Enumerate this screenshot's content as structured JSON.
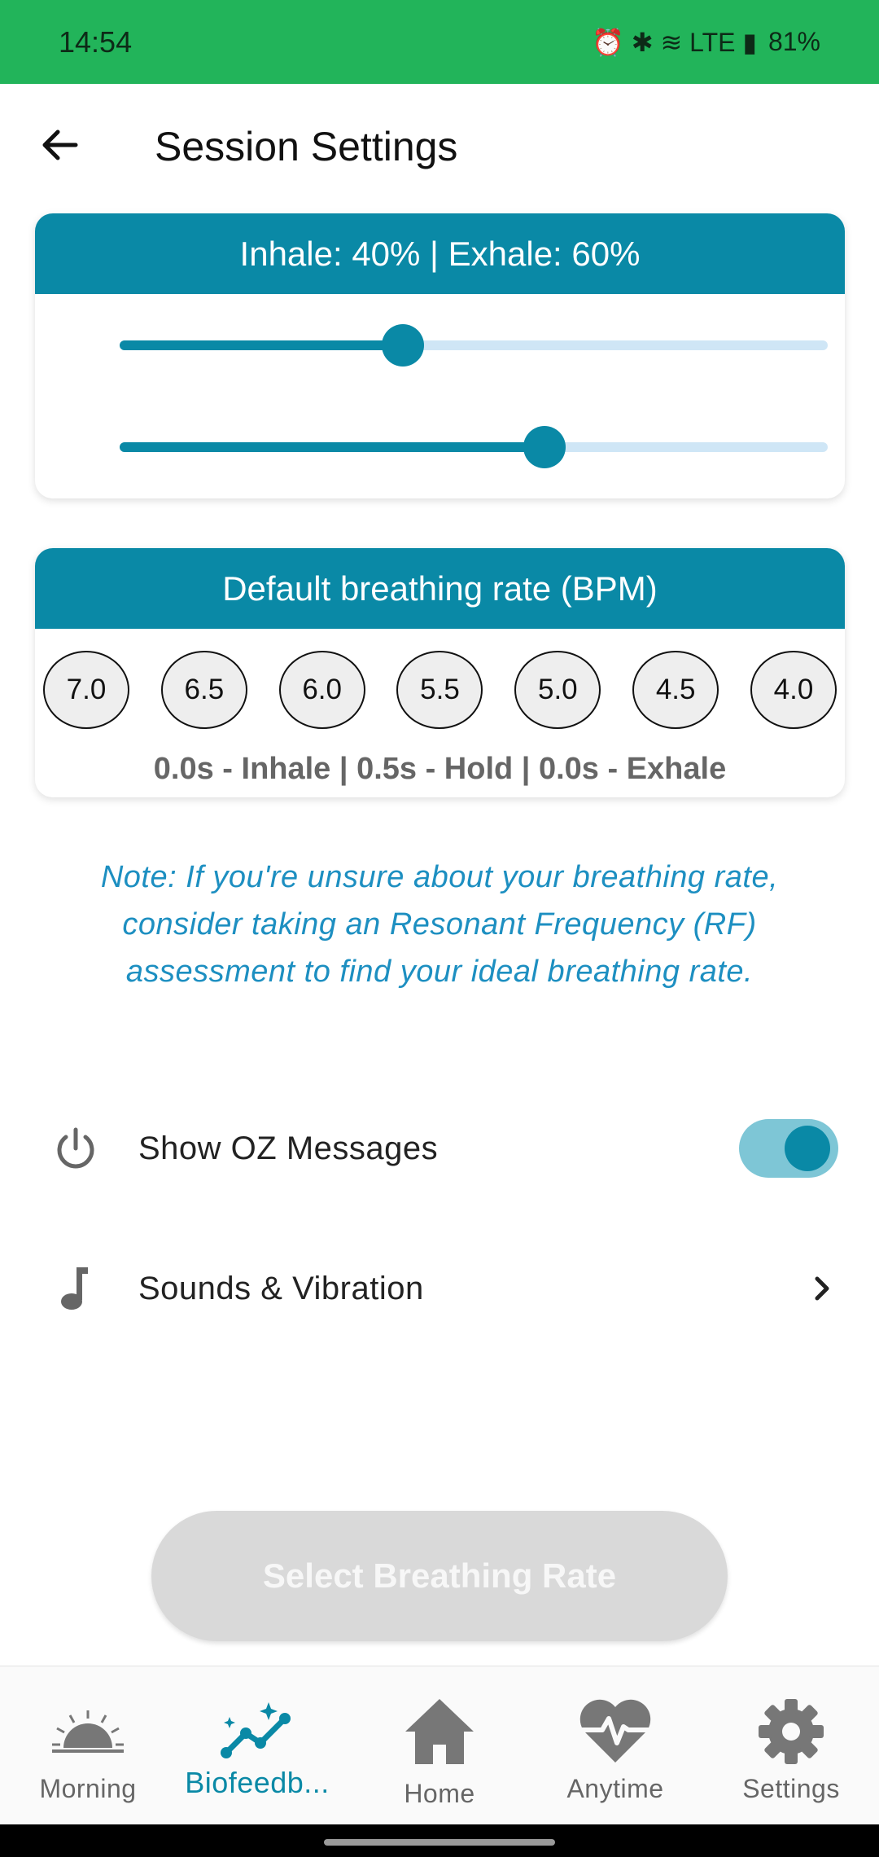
{
  "status_bar": {
    "time": "14:54",
    "indicators": "⏰ ✱ ≋ LTE ▮",
    "battery": "81%"
  },
  "header": {
    "back_icon": "arrow-left-icon",
    "title": "Session Settings"
  },
  "ratio_card": {
    "title": "Inhale: 40% | Exhale: 60%",
    "inhale_value": 0.4,
    "exhale_value": 0.6,
    "accent": "#0a89a6",
    "track": "#cfe6f6"
  },
  "rate_card": {
    "title": "Default breathing rate (BPM)",
    "rates": [
      "7.0",
      "6.5",
      "6.0",
      "5.5",
      "5.0",
      "4.5",
      "4.0"
    ],
    "detail": "0.0s - Inhale | 0.5s - Hold | 0.0s - Exhale"
  },
  "note": "Note: If you're unsure about your breathing rate, consider taking an Resonant Frequency (RF) assessment to find your ideal breathing rate.",
  "settings": {
    "oz_messages": {
      "label": "Show OZ Messages",
      "icon": "power-icon",
      "enabled": true
    },
    "sounds": {
      "label": "Sounds & Vibration",
      "icon": "music-note-icon"
    }
  },
  "cta": {
    "label": "Select Breathing Rate"
  },
  "bottom_nav": [
    {
      "label": "Morning",
      "icon": "sunrise-icon"
    },
    {
      "label": "Biofeedb...",
      "icon": "biofeedback-chart-icon",
      "active": true
    },
    {
      "label": "Home",
      "icon": "home-icon"
    },
    {
      "label": "Anytime",
      "icon": "heart-pulse-icon"
    },
    {
      "label": "Settings",
      "icon": "gear-icon"
    }
  ]
}
